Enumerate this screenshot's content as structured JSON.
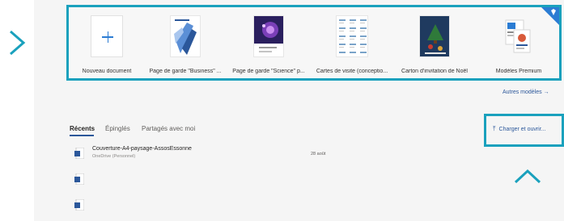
{
  "accent_color": "#1aa1bd",
  "brand_color": "#2b579a",
  "templates": [
    {
      "label": "Nouveau document",
      "icon": "plus-icon"
    },
    {
      "label": "Page de garde \"Business\" ..."
    },
    {
      "label": "Page de garde \"Science\" p..."
    },
    {
      "label": "Cartes de visite (conceptio..."
    },
    {
      "label": "Carton d'invitation de Noël"
    },
    {
      "label": "Modèles Premium",
      "icon": "diamond-icon"
    }
  ],
  "more_templates_label": "Autres modèles →",
  "tabs": [
    "Récents",
    "Épinglés",
    "Partagés avec moi"
  ],
  "upload": {
    "label": "Charger et ouvrir...",
    "icon": "upload-icon"
  },
  "files": [
    {
      "name": "Couverture-A4-paysage-AssosEssonne",
      "location": "OneDrive (Personnel)",
      "date": "28 août"
    },
    {
      "name": "",
      "location": "",
      "date": ""
    },
    {
      "name": "",
      "location": "",
      "date": ""
    }
  ]
}
